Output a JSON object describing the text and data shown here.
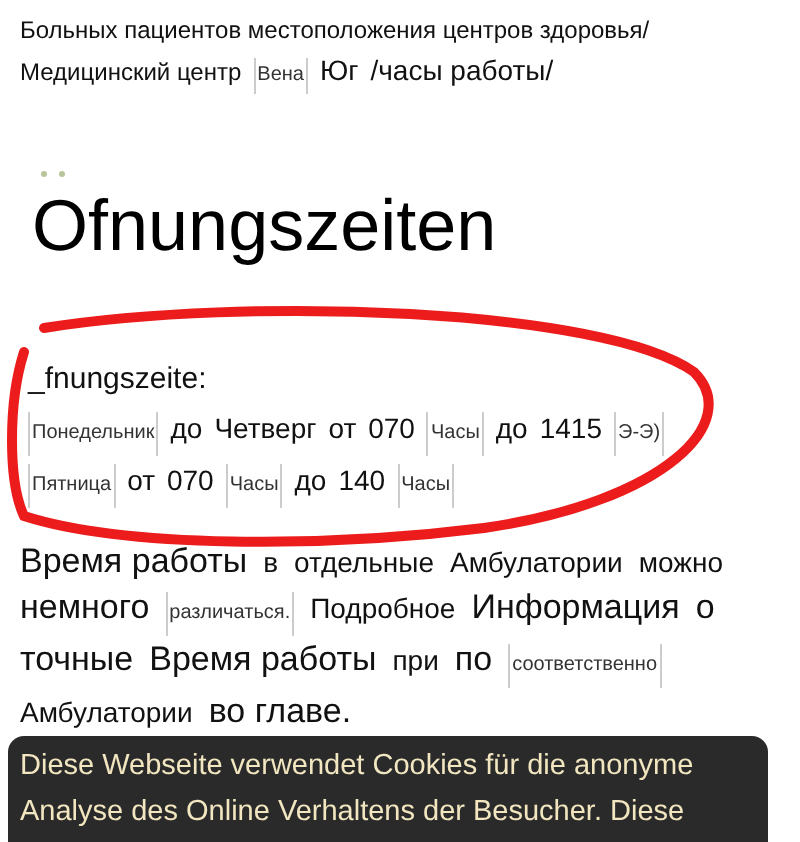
{
  "breadcrumb": [
    {
      "segments": [
        {
          "kind": "word",
          "text": "Больных пациентов местоположения центров здоровья/"
        }
      ]
    },
    {
      "segments": [
        {
          "kind": "word",
          "text": "Медицинский центр"
        },
        {
          "kind": "note",
          "text": "Вена"
        },
        {
          "kind": "large",
          "text": "Юг"
        },
        {
          "kind": "large",
          "text": "/часы работы/"
        }
      ]
    }
  ],
  "heading": "Ofnungszeiten",
  "hours": {
    "title": "_fnungszeite:",
    "rows": [
      {
        "segments": [
          {
            "kind": "note",
            "text": "Понедельник"
          },
          {
            "kind": "word",
            "text": "до"
          },
          {
            "kind": "word",
            "text": "Четверг"
          },
          {
            "kind": "word",
            "text": "от"
          },
          {
            "kind": "word",
            "text": "070"
          },
          {
            "kind": "note",
            "text": "Часы"
          },
          {
            "kind": "word",
            "text": "до"
          },
          {
            "kind": "word",
            "text": "1415"
          },
          {
            "kind": "note",
            "text": "Э-Э)"
          }
        ]
      },
      {
        "segments": [
          {
            "kind": "note",
            "text": "Пятница"
          },
          {
            "kind": "word",
            "text": "от"
          },
          {
            "kind": "word",
            "text": "070"
          },
          {
            "kind": "note",
            "text": "Часы"
          },
          {
            "kind": "word",
            "text": "до"
          },
          {
            "kind": "word",
            "text": "140"
          },
          {
            "kind": "note",
            "text": "Часы"
          }
        ]
      }
    ]
  },
  "paragraph": [
    {
      "segments": [
        {
          "kind": "large",
          "text": "Время работы"
        },
        {
          "kind": "word",
          "text": "в"
        },
        {
          "kind": "word",
          "text": "отдельные"
        },
        {
          "kind": "word",
          "text": "Амбулатории"
        },
        {
          "kind": "word",
          "text": "можно"
        }
      ]
    },
    {
      "segments": [
        {
          "kind": "large",
          "text": "немного"
        },
        {
          "kind": "note",
          "text": "различаться."
        },
        {
          "kind": "word",
          "text": "Подробное"
        },
        {
          "kind": "large",
          "text": "Информация"
        },
        {
          "kind": "large",
          "text": "о"
        }
      ]
    },
    {
      "segments": [
        {
          "kind": "large",
          "text": "точные"
        },
        {
          "kind": "large",
          "text": "Время работы"
        },
        {
          "kind": "word",
          "text": "при"
        },
        {
          "kind": "large",
          "text": "по"
        },
        {
          "kind": "note",
          "text": "соответственно"
        }
      ]
    },
    {
      "segments": [
        {
          "kind": "word",
          "text": "Амбулатории"
        },
        {
          "kind": "large",
          "text": "во главе."
        }
      ]
    }
  ],
  "cookie_banner": {
    "lines": [
      "Diese Webseite verwendet Cookies für die anonyme",
      "Analyse des Online Verhaltens der Besucher. Diese"
    ]
  }
}
